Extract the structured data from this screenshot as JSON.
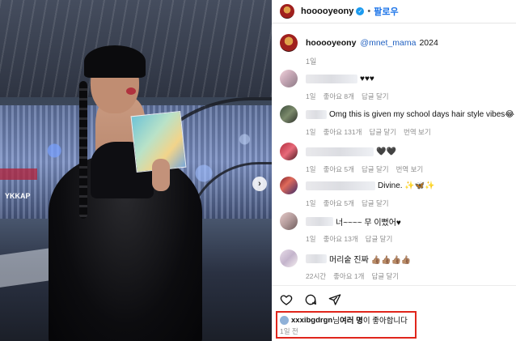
{
  "header": {
    "username": "hooooyeony",
    "separator": "•",
    "follow_label": "팔로우"
  },
  "caption": {
    "username": "hooooyeony",
    "mention": "@mnet_mama",
    "text": "2024",
    "time": "1일"
  },
  "comments": [
    {
      "text": "♥♥♥",
      "time": "1일",
      "likes": "좋아요 8개",
      "reply": "답글 달기",
      "extra": ""
    },
    {
      "text": "Omg this is given my school days hair style vibes😂",
      "time": "1일",
      "likes": "좋아요 131개",
      "reply": "답글 달기",
      "extra": "번역 보기"
    },
    {
      "text": "🖤🖤",
      "time": "1일",
      "likes": "좋아요 5개",
      "reply": "답글 달기",
      "extra": "번역 보기"
    },
    {
      "text": "Divine. ✨🦋✨",
      "time": "1일",
      "likes": "좋아요 5개",
      "reply": "답글 달기",
      "extra": ""
    },
    {
      "text": "너~~~~ 무 이뻤어♥",
      "time": "1일",
      "likes": "좋아요 13개",
      "reply": "답글 달기",
      "extra": ""
    },
    {
      "text": "머리숱 진짜 👍🏽👍🏽👍🏽👍🏽",
      "time": "22시간",
      "likes": "좋아요 1개",
      "reply": "답글 달기",
      "extra": ""
    }
  ],
  "likes_summary": {
    "user": "xxxibgdrgn",
    "middle": "님 ",
    "bold": "여러 명",
    "end": "이 좋아합니다",
    "time": "1일 전"
  },
  "photo": {
    "sign_text": "YKKAP"
  },
  "icons": {
    "like": "heart-outline-icon",
    "comment": "comment-bubble-icon",
    "share": "paper-plane-icon",
    "verified": "verified-badge-icon",
    "next": "chevron-right-icon"
  },
  "colors": {
    "follow": "#1a73e8",
    "verified": "#1c9bf0",
    "highlight_box": "#e0261c"
  }
}
